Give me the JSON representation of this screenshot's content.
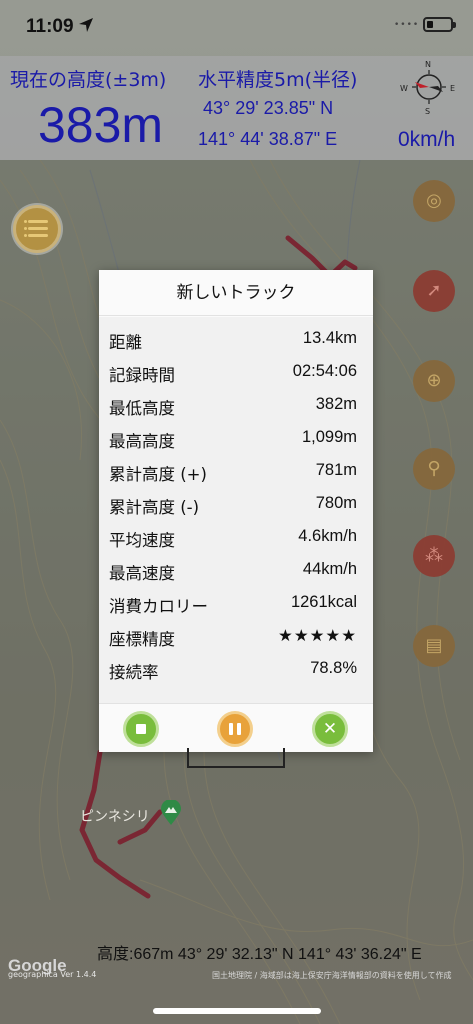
{
  "status_bar": {
    "time": "11:09",
    "signal": "••••"
  },
  "header": {
    "altitude_label": "現在の高度(±3m)",
    "altitude_value": "383m",
    "accuracy_label": "水平精度5m(半径)",
    "latitude": "43° 29' 23.85\" N",
    "longitude": "141° 44' 38.87\" E",
    "speed": "0km/h",
    "compass_letters": [
      "N",
      "E",
      "S",
      "W"
    ]
  },
  "dialog": {
    "title": "新しいトラック",
    "rows": [
      {
        "label": "距離",
        "value": "13.4km"
      },
      {
        "label": "記録時間",
        "value": "02:54:06"
      },
      {
        "label": "最低高度",
        "value": "382m"
      },
      {
        "label": "最高高度",
        "value": "1,099m"
      },
      {
        "label": "累計高度 (+)",
        "value": "781m"
      },
      {
        "label": "累計高度 (-)",
        "value": "780m"
      },
      {
        "label": "平均速度",
        "value": "4.6km/h"
      },
      {
        "label": "最高速度",
        "value": "44km/h"
      },
      {
        "label": "消費カロリー",
        "value": "1261kcal"
      },
      {
        "label": "座標精度",
        "value": "★★★★★"
      },
      {
        "label": "接続率",
        "value": "78.8%"
      }
    ],
    "buttons": {
      "stop": "stop-icon",
      "pause": "pause-icon",
      "close": "✕"
    }
  },
  "map": {
    "peak_label": "ピンネシリ",
    "cursor_info": "高度:667m  43° 29' 32.13\" N 141° 43' 36.24\" E",
    "google_logo": "Google",
    "app_version": "geographica Ver 1.4.4",
    "credit": "国土地理院 / 海域部は海上保安庁海洋情報部の資料を使用して作成",
    "track_color": "#9b1c2e"
  },
  "tools": [
    "list-icon",
    "camera-icon",
    "compass-icon",
    "target-icon",
    "pin-icon",
    "footprints-icon",
    "log-icon"
  ]
}
